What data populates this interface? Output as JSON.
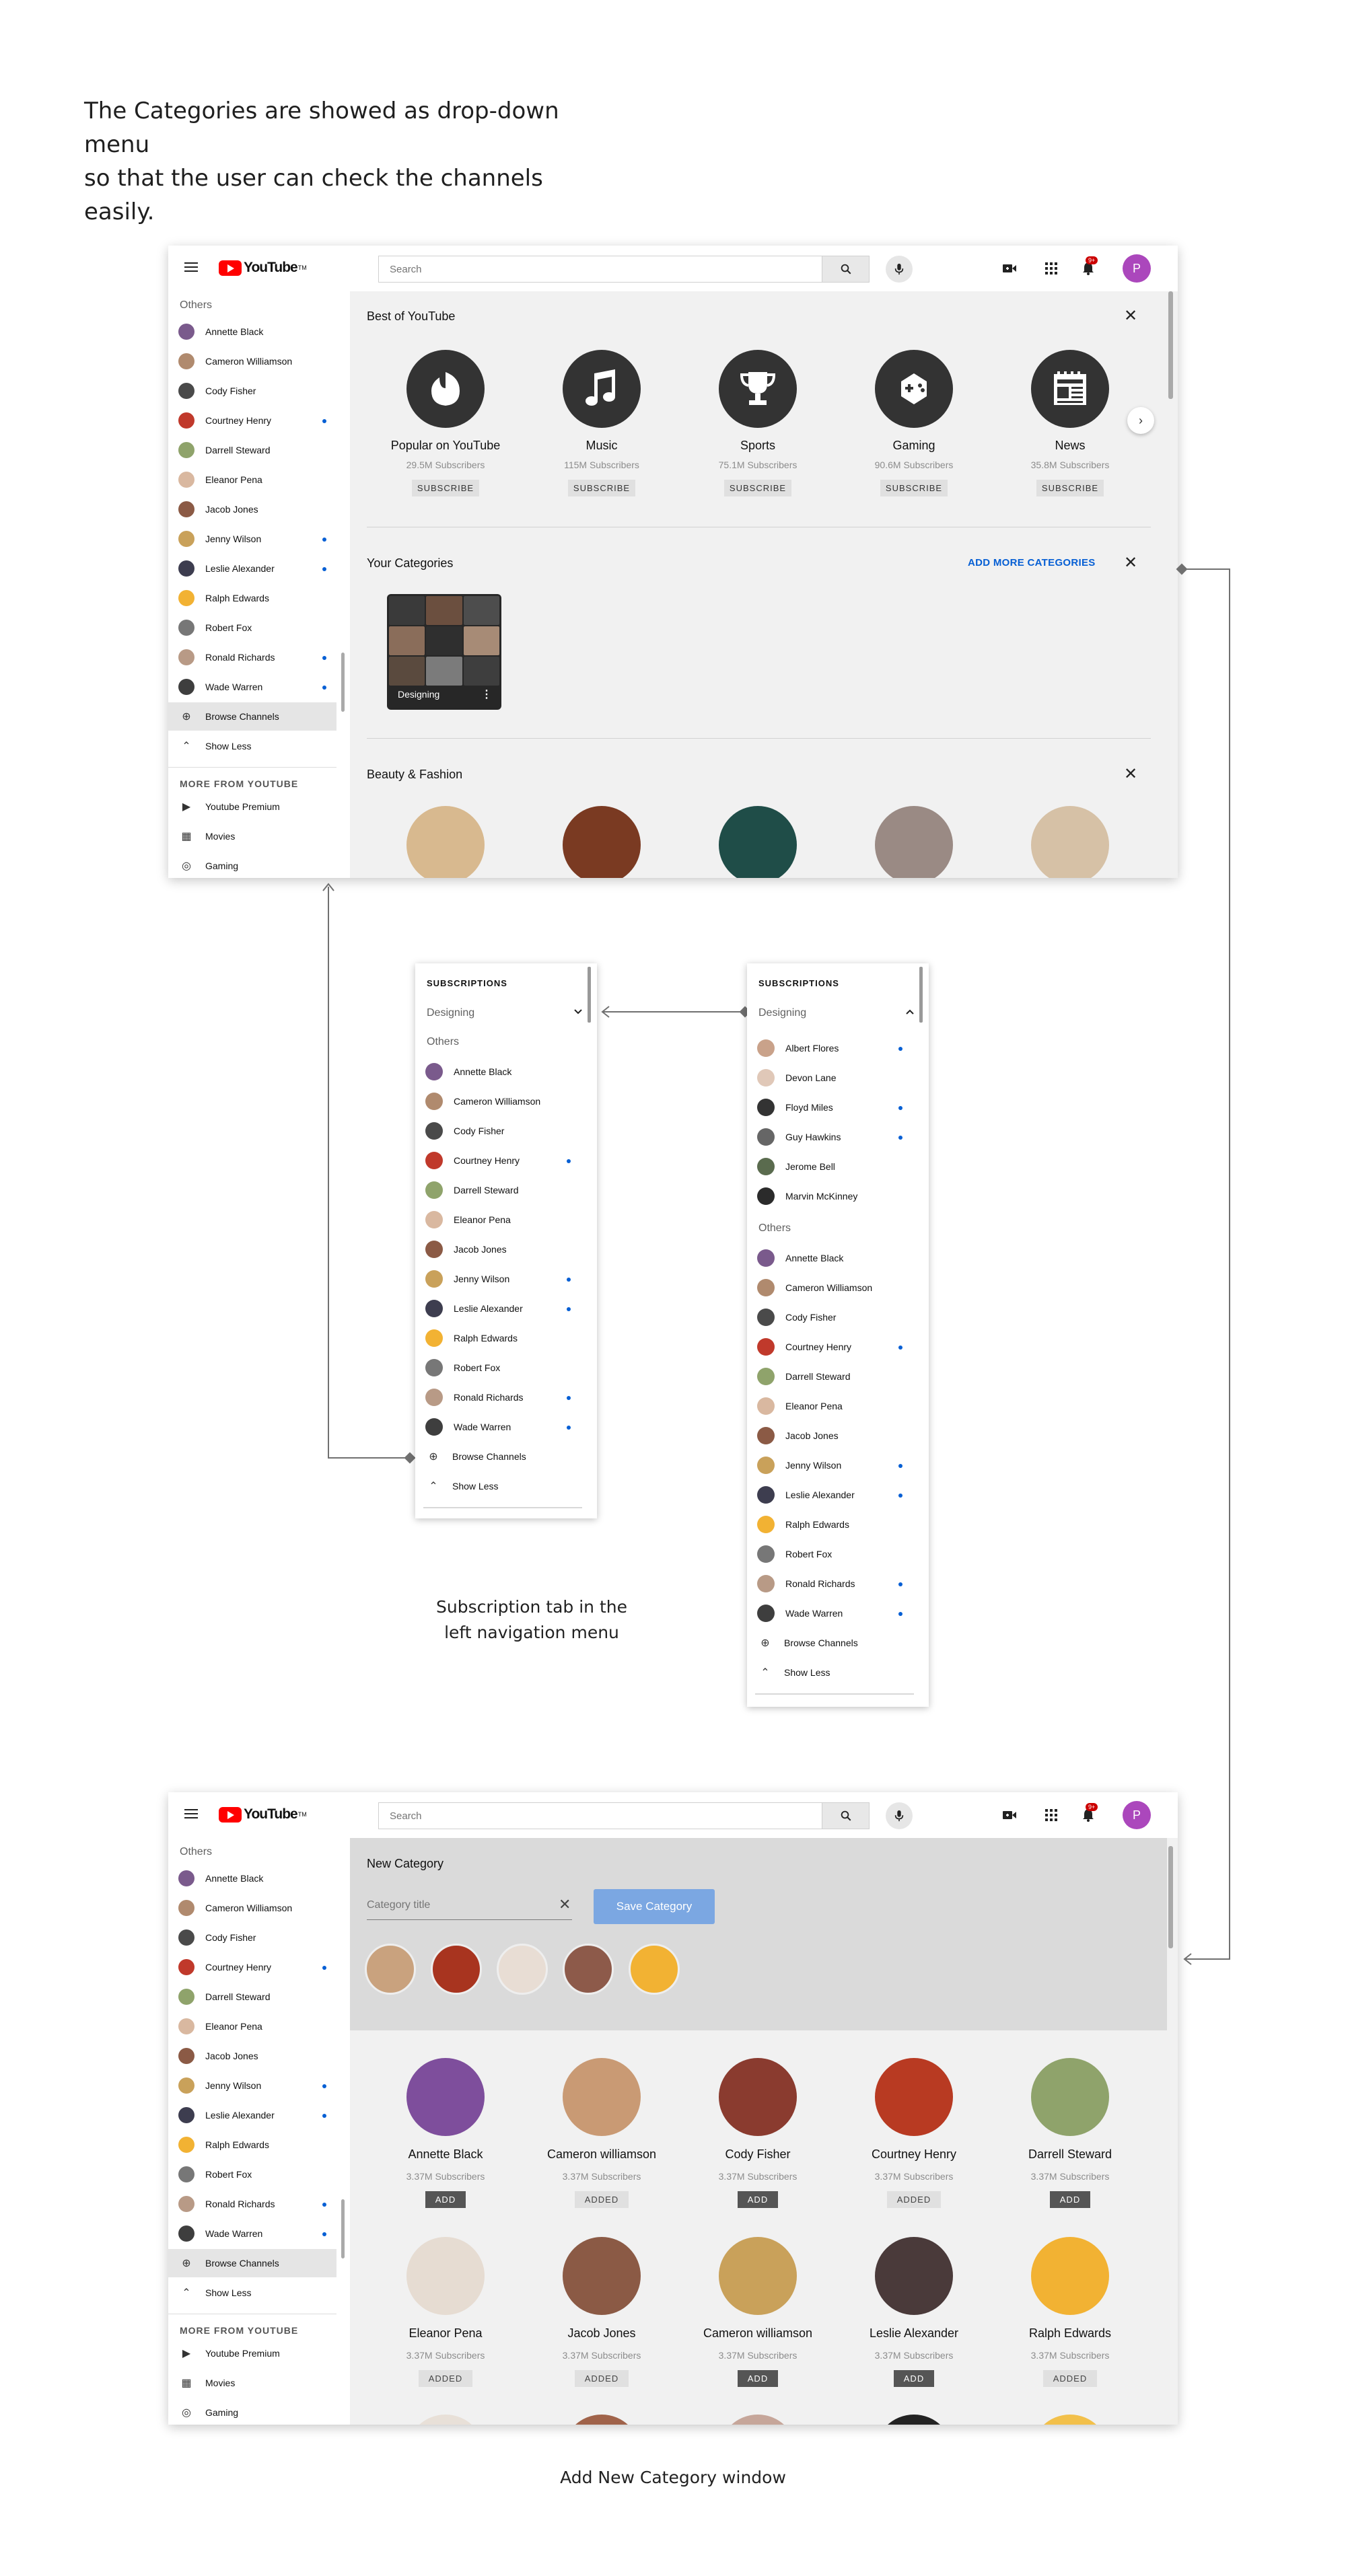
{
  "intro": {
    "line1": "The Categories are showed as drop-down menu",
    "line2": "so that the user can check the channels easily."
  },
  "captions": {
    "subscription_line1": "Subscription tab in the",
    "subscription_line2": "left navigation menu",
    "new_category": "Add New Category window"
  },
  "topbar": {
    "logo_text": "YouTube",
    "logo_tm": "TM",
    "search_placeholder": "Search",
    "notif_count": "9+",
    "avatar_letter": "P"
  },
  "sidebar": {
    "others_label": "Others",
    "channels": [
      {
        "name": "Annette Black",
        "dot": false,
        "color": "#7a5a8c"
      },
      {
        "name": "Cameron Williamson",
        "dot": false,
        "color": "#b08a6e"
      },
      {
        "name": "Cody Fisher",
        "dot": false,
        "color": "#4a4a4a"
      },
      {
        "name": "Courtney Henry",
        "dot": true,
        "color": "#c0392b"
      },
      {
        "name": "Darrell Steward",
        "dot": false,
        "color": "#8fa36b"
      },
      {
        "name": "Eleanor Pena",
        "dot": false,
        "color": "#d9b8a0"
      },
      {
        "name": "Jacob Jones",
        "dot": false,
        "color": "#8b5a45"
      },
      {
        "name": "Jenny Wilson",
        "dot": true,
        "color": "#c9a15a"
      },
      {
        "name": "Leslie Alexander",
        "dot": true,
        "color": "#3d3d4f"
      },
      {
        "name": "Ralph Edwards",
        "dot": false,
        "color": "#f2b233"
      },
      {
        "name": "Robert Fox",
        "dot": false,
        "color": "#777777"
      },
      {
        "name": "Ronald Richards",
        "dot": true,
        "color": "#b89a86"
      },
      {
        "name": "Wade Warren",
        "dot": true,
        "color": "#3e3e3e"
      }
    ],
    "browse_channels": "Browse Channels",
    "show_less": "Show Less",
    "more_from_youtube": "MORE FROM YOUTUBE",
    "more_items": [
      "Youtube Premium",
      "Movies",
      "Gaming"
    ]
  },
  "window1": {
    "best_title": "Best of YouTube",
    "best_channels": [
      {
        "name": "Popular on YouTube",
        "subs": "29.5M Subscribers",
        "icon": "popular-icon"
      },
      {
        "name": "Music",
        "subs": "115M Subscribers",
        "icon": "music-icon"
      },
      {
        "name": "Sports",
        "subs": "75.1M Subscribers",
        "icon": "trophy-icon"
      },
      {
        "name": "Gaming",
        "subs": "90.6M Subscribers",
        "icon": "gamepad-icon"
      },
      {
        "name": "News",
        "subs": "35.8M Subscribers",
        "icon": "newspaper-icon"
      }
    ],
    "subscribe_label": "SUBSCRIBE",
    "your_categories_title": "Your Categories",
    "add_more_label": "ADD MORE CATEGORIES",
    "category_card_label": "Designing",
    "beauty_title": "Beauty & Fashion"
  },
  "panel_left": {
    "heading": "SUBSCRIPTIONS",
    "category": "Designing",
    "others_label": "Others"
  },
  "panel_right": {
    "heading": "SUBSCRIPTIONS",
    "category": "Designing",
    "designing_channels": [
      {
        "name": "Albert Flores",
        "dot": true,
        "color": "#c9a28a"
      },
      {
        "name": "Devon Lane",
        "dot": false,
        "color": "#e0c8b8"
      },
      {
        "name": "Floyd Miles",
        "dot": true,
        "color": "#333333"
      },
      {
        "name": "Guy Hawkins",
        "dot": true,
        "color": "#666666"
      },
      {
        "name": "Jerome Bell",
        "dot": false,
        "color": "#5a6b4e"
      },
      {
        "name": "Marvin McKinney",
        "dot": false,
        "color": "#2b2b2b"
      }
    ],
    "others_label": "Others"
  },
  "window3": {
    "new_category_title": "New Category",
    "category_placeholder": "Category title",
    "save_label": "Save Category",
    "selected_colors": [
      "#c9a27e",
      "#a8341f",
      "#e8ddd4",
      "#8d5a4a",
      "#f2b233"
    ],
    "grid": [
      {
        "name": "Annette Black",
        "subs": "3.37M Subscribers",
        "state": "ADD",
        "color": "#7e4e9c"
      },
      {
        "name": "Cameron williamson",
        "subs": "3.37M Subscribers",
        "state": "ADDED",
        "color": "#c99a74"
      },
      {
        "name": "Cody Fisher",
        "subs": "3.37M Subscribers",
        "state": "ADD",
        "color": "#8a3b2f"
      },
      {
        "name": "Courtney Henry",
        "subs": "3.37M Subscribers",
        "state": "ADDED",
        "color": "#b83a22"
      },
      {
        "name": "Darrell Steward",
        "subs": "3.37M Subscribers",
        "state": "ADD",
        "color": "#8fa36b"
      },
      {
        "name": "Eleanor Pena",
        "subs": "3.37M Subscribers",
        "state": "ADDED",
        "color": "#e6dcd2"
      },
      {
        "name": "Jacob Jones",
        "subs": "3.37M Subscribers",
        "state": "ADDED",
        "color": "#8b5a45"
      },
      {
        "name": "Cameron williamson",
        "subs": "3.37M Subscribers",
        "state": "ADD",
        "color": "#c9a15a"
      },
      {
        "name": "Leslie Alexander",
        "subs": "3.37M Subscribers",
        "state": "ADD",
        "color": "#4a3a3a"
      },
      {
        "name": "Ralph Edwards",
        "subs": "3.37M Subscribers",
        "state": "ADDED",
        "color": "#f2b233"
      }
    ]
  }
}
